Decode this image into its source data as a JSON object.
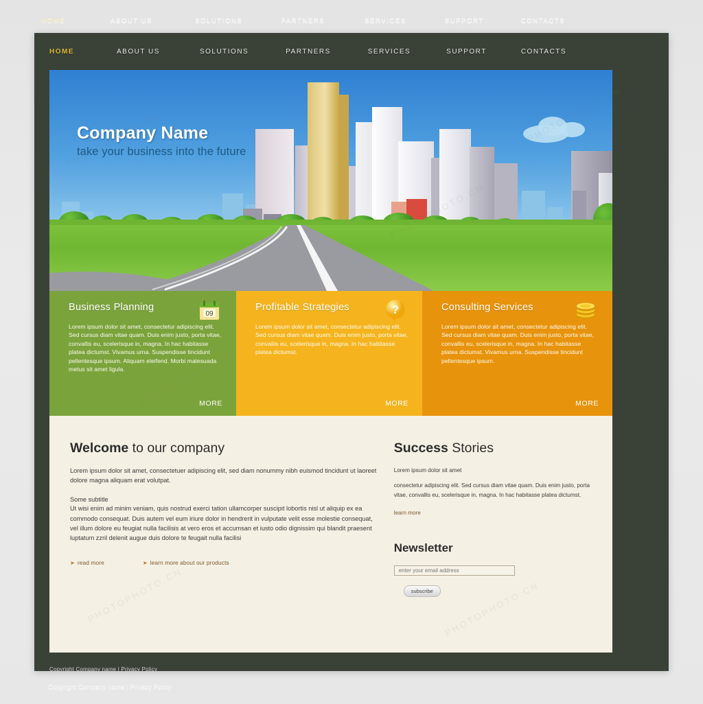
{
  "site": {
    "outer_bg": "#e9e9e9",
    "page_bg": "#3a4238",
    "content_bg": "#f5f0e4",
    "accent_active": "#dcb82e"
  },
  "nav": {
    "items": [
      {
        "label": "HOME",
        "active": true
      },
      {
        "label": "ABOUT US",
        "active": false
      },
      {
        "label": "SOLUTIONS",
        "active": false
      },
      {
        "label": "PARTNERS",
        "active": false
      },
      {
        "label": "SERVICES",
        "active": false
      },
      {
        "label": "SUPPORT",
        "active": false
      },
      {
        "label": "CONTACTS",
        "active": false
      }
    ]
  },
  "hero": {
    "title": "Company Name",
    "subtitle": "take your business into the future"
  },
  "features": [
    {
      "title": "Business Planning",
      "icon": "calendar-icon",
      "icon_label": "09",
      "color": "#7ba33c",
      "text": "Lorem ipsum dolor sit amet, consectetur adipiscing elit. Sed cursus diam vitae quam. Duis enim justo, porta vitae, convallis eu, scelerisque in, magna. In hac habitasse platea dictumst. Vivamus urna. Suspendisse tincidunt pellentesque ipsum. Aliquam eleifend. Morbi malesuada metus sit amet ligula.",
      "more_label": "MORE"
    },
    {
      "title": "Profitable Strategies",
      "icon": "question-bubble-icon",
      "icon_label": "?",
      "color": "#f5b41e",
      "text": "Lorem ipsum dolor sit amet, consectetur adipiscing elit. Sed cursus diam vitae quam. Duis enim justo, porta vitae, convallis eu, scelerisque in, magna. In hac habitasse platea dictumst.",
      "more_label": "MORE"
    },
    {
      "title": "Consulting Services",
      "icon": "coins-icon",
      "icon_label": "",
      "color": "#e8930c",
      "text": "Lorem ipsum dolor sit amet, consectetur adipiscing elit. Sed cursus diam vitae quam. Duis enim justo, porta vitae, convallis eu, scelerisque in, magna. In hac habitasse platea dictumst. Vivamus urna. Suspendisse tincidunt pellentesque ipsum.",
      "more_label": "MORE"
    }
  ],
  "welcome": {
    "heading_bold": "Welcome",
    "heading_rest": " to our company",
    "intro": "Lorem ipsum dolor sit amet, consectetuer adipiscing elit, sed diam nonummy nibh euismod tincidunt ut laoreet dolore magna aliquam erat volutpat.",
    "subtitle": "Some subtitle",
    "body": "Ut wisi enim ad minim veniam, quis nostrud exerci tation ullamcorper suscipit lobortis nisl ut aliquip ex ea commodo consequat. Duis autem vel eum iriure dolor in hendrerit in vulputate velit esse molestie consequat, vel illum dolore eu feugiat nulla facilisis at vero eros et accumsan et iusto odio dignissim qui blandit praesent luptatum zzril delenit augue duis dolore te feugait nulla facilisi",
    "link_read_more": "read more",
    "link_products": "learn more about our products",
    "arrow_glyph": "➤"
  },
  "success": {
    "heading_bold": "Success",
    "heading_rest": " Stories",
    "line1": "Lorem ipsum dolor sit amet",
    "line2": "consectetur adipiscing elit. Sed cursus diam vitae quam. Duis enim justo, porta vitae, convallis eu, scelerisque in, magna. In hac habitasse platea dictumst.",
    "link": "learn more"
  },
  "newsletter": {
    "heading": "Newsletter",
    "email_placeholder": "enter your email address",
    "email_value": "",
    "subscribe_label": "subscribe"
  },
  "footer": {
    "copyright": "Copyright Company name | Privacy Policy"
  },
  "watermark": {
    "text": "PHOTOPHOTO.CN"
  }
}
